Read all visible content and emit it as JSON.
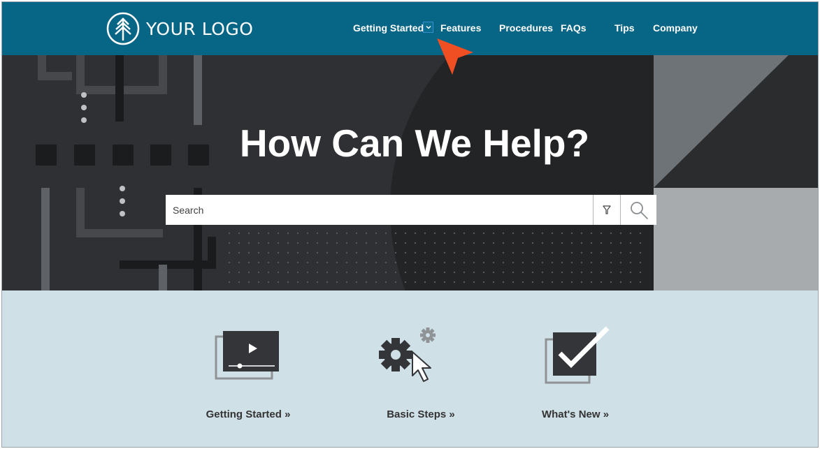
{
  "header": {
    "logo_text": "YOUR LOGO",
    "logo_icon": "tree-icon",
    "nav": [
      {
        "label": "Getting Started"
      },
      {
        "label": "Features"
      },
      {
        "label": "Procedures"
      },
      {
        "label": "FAQs"
      },
      {
        "label": "Tips"
      },
      {
        "label": "Company"
      }
    ],
    "dropdown_icon": "chevron-down-icon"
  },
  "hero": {
    "title": "How Can We Help?",
    "search_placeholder": "Search",
    "filter_icon": "filter-icon",
    "search_icon": "magnifier-icon"
  },
  "tiles": [
    {
      "label": "Getting Started »",
      "icon": "video-player-icon"
    },
    {
      "label": "Basic Steps »",
      "icon": "gears-cursor-icon"
    },
    {
      "label": "What's New »",
      "icon": "checkbox-icon"
    }
  ],
  "colors": {
    "header_bg": "#076585",
    "hero_bg": "#2f3033",
    "tiles_bg": "#cfe0e7",
    "cursor_accent": "#f04e23"
  }
}
